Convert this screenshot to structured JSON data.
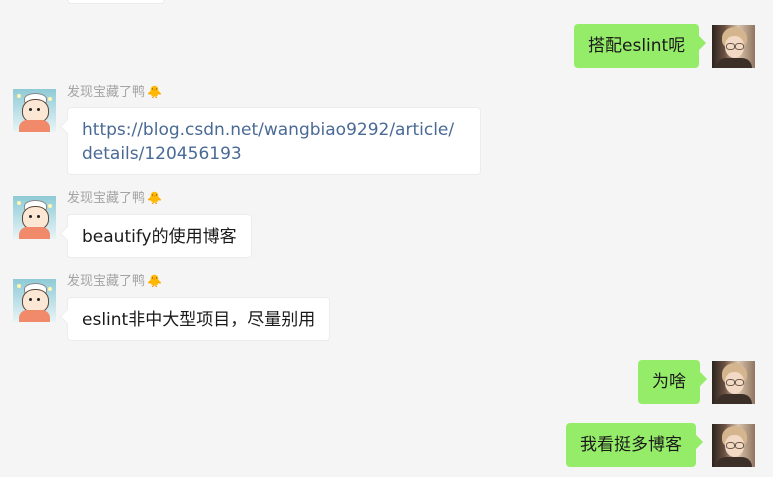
{
  "messages": [
    {
      "id": "m1",
      "direction": "out",
      "text": "搭配eslint呢"
    },
    {
      "id": "m2",
      "direction": "in",
      "sender": "发现宝藏了鸭",
      "sender_emoji": "🐥",
      "text": "https://blog.csdn.net/wangbiao9292/article/details/120456193",
      "lines": [
        "https://blog.csdn.net/wangbiao9292/article/",
        "details/120456193"
      ]
    },
    {
      "id": "m3",
      "direction": "in",
      "sender": "发现宝藏了鸭",
      "sender_emoji": "🐥",
      "text": "beautify的使用博客"
    },
    {
      "id": "m4",
      "direction": "in",
      "sender": "发现宝藏了鸭",
      "sender_emoji": "🐥",
      "text": "eslint非中大型项目，尽量别用"
    },
    {
      "id": "m5",
      "direction": "out",
      "text": "为啥"
    },
    {
      "id": "m6",
      "direction": "out",
      "text": "我看挺多博客"
    }
  ],
  "colors": {
    "background": "#f5f5f5",
    "outgoing_bubble": "#95ec69",
    "incoming_bubble": "#ffffff",
    "link": "#496a95",
    "sender_name": "#a3a3a3"
  }
}
